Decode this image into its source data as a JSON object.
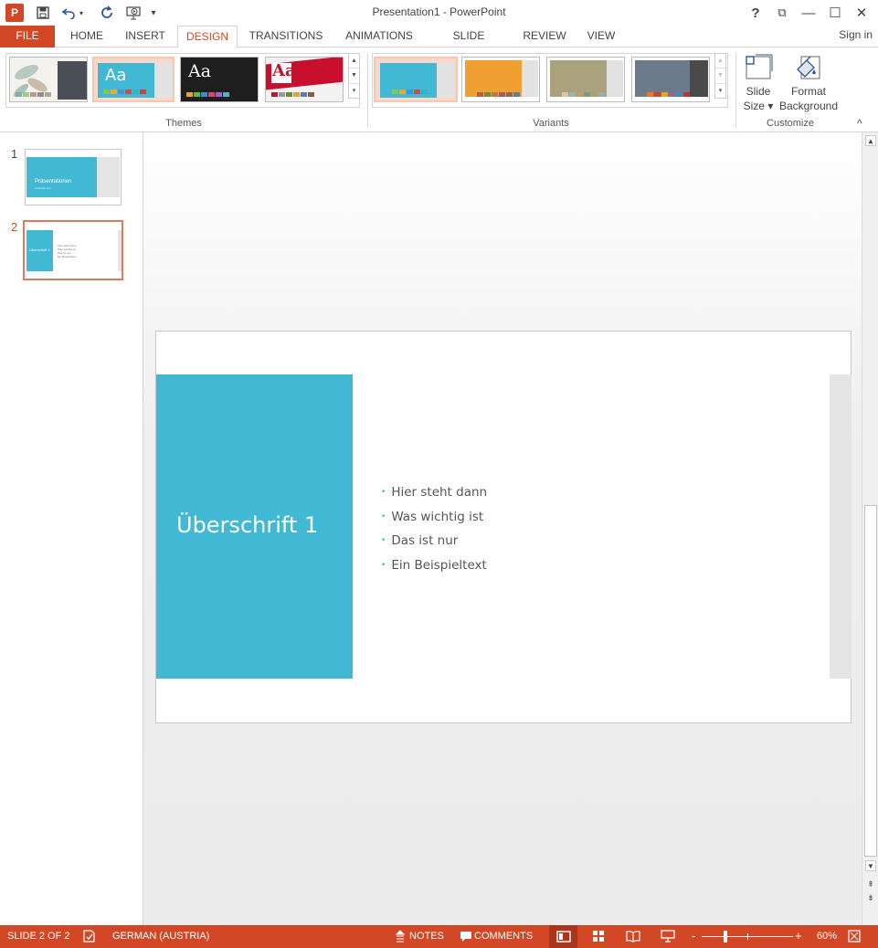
{
  "window": {
    "title": "Presentation1 - PowerPoint",
    "app_icon_letter": "P",
    "help": "?",
    "ribbon_display": "⧉",
    "minimize": "—",
    "maximize": "☐",
    "close": "✕"
  },
  "tabs": [
    {
      "label": "FILE"
    },
    {
      "label": "HOME"
    },
    {
      "label": "INSERT"
    },
    {
      "label": "DESIGN"
    },
    {
      "label": "TRANSITIONS"
    },
    {
      "label": "ANIMATIONS"
    },
    {
      "label": "SLIDE SHOW"
    },
    {
      "label": "REVIEW"
    },
    {
      "label": "VIEW"
    }
  ],
  "signin": "Sign in",
  "ribbon": {
    "themes_label": "Themes",
    "variants_label": "Variants",
    "customize_label": "Customize",
    "themes": [
      {
        "text": "",
        "selected": false
      },
      {
        "text": "Aa",
        "selected": true
      },
      {
        "text": "Aa",
        "selected": false
      },
      {
        "text": "Aa",
        "selected": false
      }
    ],
    "slide_size_line1": "Slide",
    "slide_size_line2": "Size ▾",
    "format_bg_line1": "Format",
    "format_bg_line2": "Background",
    "collapse": "^"
  },
  "slides": [
    {
      "number": "1",
      "title": "Präsentationen",
      "subtitle": "Untertitel text"
    },
    {
      "number": "2",
      "title": "Überschrift 1",
      "bullets": [
        "Hier steht dann",
        "Was wichtig ist",
        "Das ist nur",
        "Ein Beispieltext"
      ]
    }
  ],
  "current_slide": {
    "title": "Überschrift 1",
    "bullets": [
      "Hier steht dann",
      "Was wichtig ist",
      "Das ist nur",
      "Ein Beispieltext"
    ]
  },
  "status": {
    "slide_info": "SLIDE 2 OF 2",
    "language": "GERMAN (AUSTRIA)",
    "notes": "NOTES",
    "comments": "COMMENTS",
    "zoom_minus": "-",
    "zoom_plus": "+",
    "zoom": "60%"
  },
  "colors": {
    "accent": "#d24726",
    "slide_accent": "#41b8d4",
    "bullet": "#41b8d4"
  }
}
